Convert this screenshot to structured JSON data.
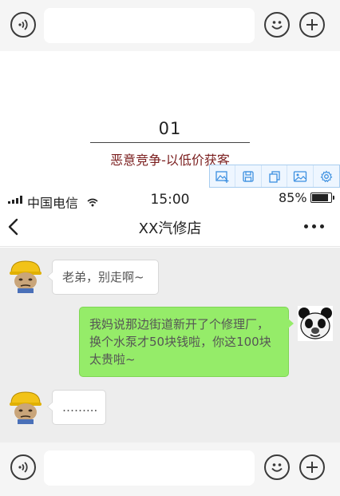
{
  "top_input_bar": {
    "voice_icon": "voice-icon",
    "emoji_icon": "emoji-icon",
    "plus_icon": "plus-icon",
    "message_value": ""
  },
  "section": {
    "number": "01",
    "subtitle": "恶意竞争-以低价获客",
    "highlight_color": "#f7d37c",
    "subtitle_color": "#7b1f1f"
  },
  "edit_toolbar": {
    "tools": [
      "add-image-icon",
      "save-icon",
      "copy-icon",
      "image-icon",
      "settings-icon"
    ],
    "accent": "#3b8fe0"
  },
  "status_bar": {
    "carrier": "中国电信",
    "time": "15:00",
    "battery": "85%",
    "battery_level": 0.85
  },
  "nav": {
    "title": "XX汽修店",
    "back_icon": "back-chevron-icon",
    "more_icon": "more-dots-icon"
  },
  "messages": [
    {
      "side": "left",
      "avatar": "worker-helmet-avatar",
      "text": "老弟，别走啊~"
    },
    {
      "side": "right",
      "avatar": "panda-meme-avatar",
      "text": "我妈说那边街道新开了个修理厂，换个水泵才50块钱啦，你这100块太贵啦~"
    },
    {
      "side": "left",
      "avatar": "worker-helmet-avatar",
      "text": "……..."
    }
  ],
  "bottom_input_bar": {
    "message_value": ""
  },
  "colors": {
    "chat_bg": "#ededed",
    "bubble_self": "#95ec69",
    "bubble_other": "#ffffff"
  }
}
